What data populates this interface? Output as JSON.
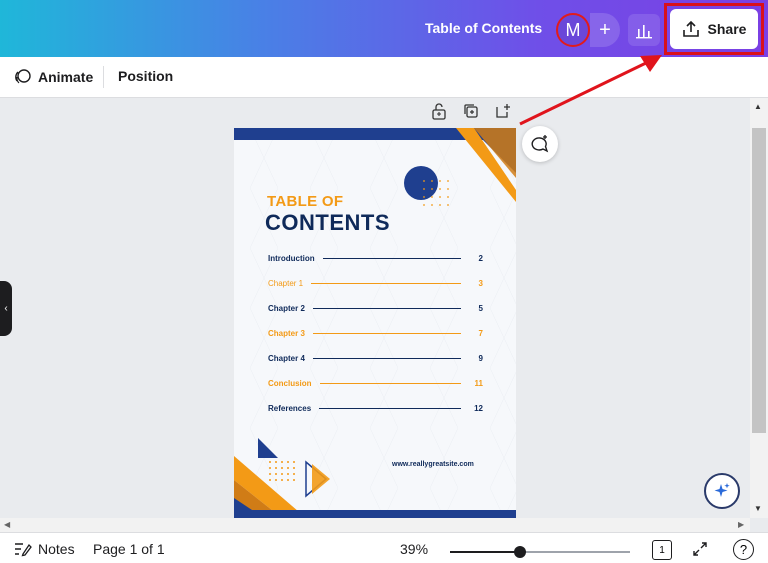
{
  "header": {
    "doc_title": "Table of Contents",
    "avatar_initial": "M",
    "add_symbol": "+",
    "share_label": "Share"
  },
  "toolbar": {
    "animate_label": "Animate",
    "position_label": "Position"
  },
  "document": {
    "heading_line1": "TABLE OF",
    "heading_line2": "CONTENTS",
    "toc": [
      {
        "label": "Introduction",
        "page": "2",
        "style": "blue"
      },
      {
        "label": "Chapter 1",
        "page": "3",
        "style": "orange"
      },
      {
        "label": "Chapter 2",
        "page": "5",
        "style": "blue"
      },
      {
        "label": "Chapter 3",
        "page": "7",
        "style": "orange"
      },
      {
        "label": "Chapter 4",
        "page": "9",
        "style": "blue"
      },
      {
        "label": "Conclusion",
        "page": "11",
        "style": "orange"
      },
      {
        "label": "References",
        "page": "12",
        "style": "blue"
      }
    ],
    "website": "www.reallygreatsite.com"
  },
  "footer": {
    "notes_label": "Notes",
    "page_indicator": "Page 1 of 1",
    "zoom_label": "39%",
    "zoom_value": 39,
    "pages_count": "1",
    "help_symbol": "?"
  },
  "colors": {
    "accent_orange": "#f39a16",
    "navy": "#0f2a5a",
    "brand_blue": "#1f3f8f",
    "highlight_red": "#d9101a"
  },
  "icons": {
    "animate": "animate-icon",
    "lock": "lock-icon",
    "duplicate": "duplicate-icon",
    "add_page": "add-page-icon",
    "comment": "comment-add-icon",
    "share": "share-upload-icon",
    "analytics": "bar-chart-icon",
    "magic": "sparkle-icon",
    "notes": "notes-icon",
    "fullscreen": "expand-icon",
    "help": "help-icon"
  }
}
